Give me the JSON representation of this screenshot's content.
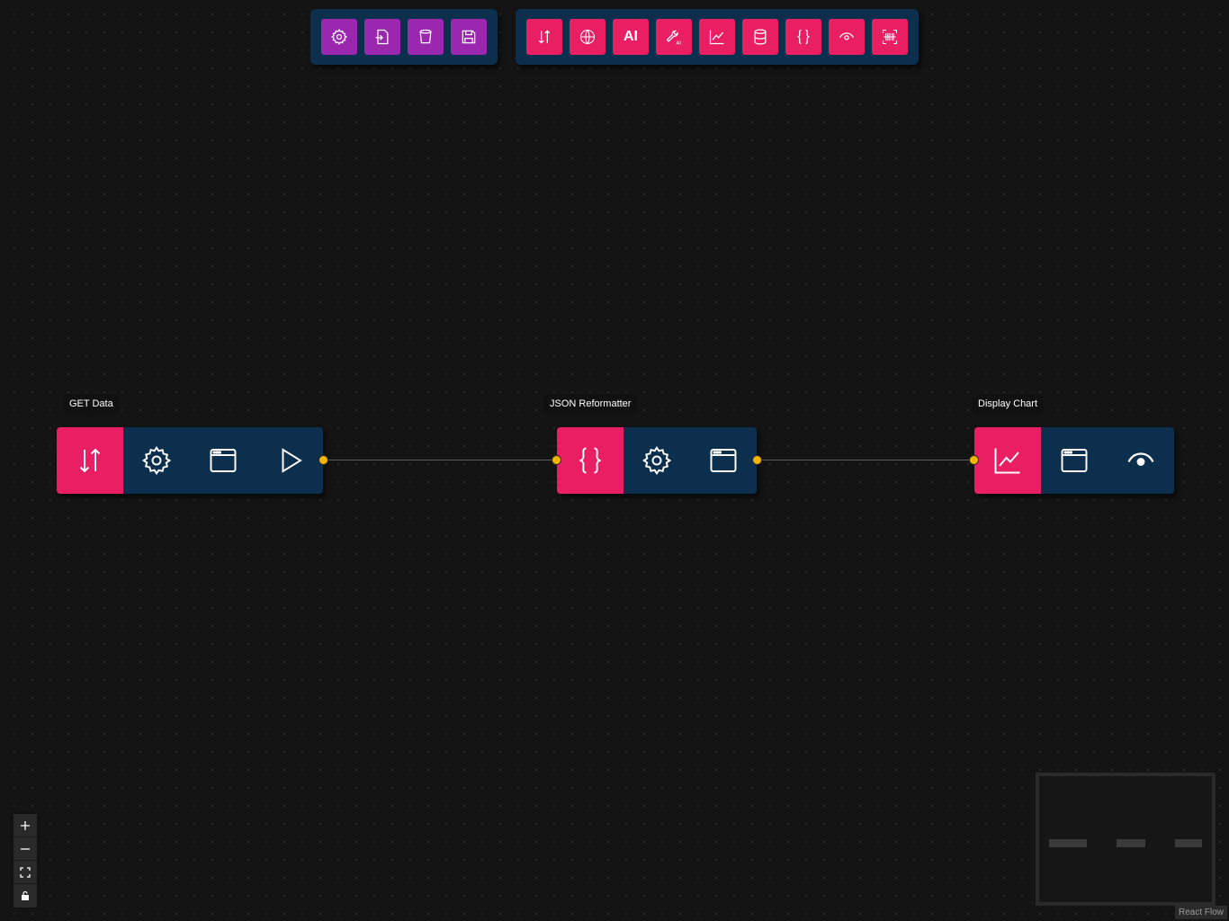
{
  "toolbar_left": {
    "buttons": [
      {
        "icon": "gear-icon",
        "color": "#9b27af"
      },
      {
        "icon": "file-import-icon",
        "color": "#9b27af"
      },
      {
        "icon": "bucket-icon",
        "color": "#9b27af"
      },
      {
        "icon": "save-icon",
        "color": "#9b27af"
      }
    ]
  },
  "toolbar_right": {
    "buttons": [
      {
        "icon": "sort-arrows-icon",
        "color": "#e91e63"
      },
      {
        "icon": "www-globe-icon",
        "color": "#e91e63"
      },
      {
        "icon": "ai-text-icon",
        "label": "AI",
        "color": "#e91e63"
      },
      {
        "icon": "ai-wrench-icon",
        "color": "#e91e63"
      },
      {
        "icon": "line-chart-icon",
        "color": "#e91e63"
      },
      {
        "icon": "database-icon",
        "color": "#e91e63"
      },
      {
        "icon": "braces-icon",
        "color": "#e91e63"
      },
      {
        "icon": "eye-icon",
        "color": "#e91e63"
      },
      {
        "icon": "barcode-scan-icon",
        "color": "#e91e63"
      }
    ]
  },
  "nodes": [
    {
      "label": "GET Data",
      "icons": [
        "sort-arrows-icon",
        "gear-icon",
        "window-icon",
        "play-icon"
      ]
    },
    {
      "label": "JSON Reformatter",
      "icons": [
        "braces-icon",
        "gear-icon",
        "window-icon"
      ]
    },
    {
      "label": "Display Chart",
      "icons": [
        "line-chart-icon",
        "window-icon",
        "eye-icon"
      ]
    }
  ],
  "controls": {
    "icons": [
      "zoom-in-icon",
      "zoom-out-icon",
      "fit-view-icon",
      "lock-icon"
    ]
  },
  "attribution": "React Flow",
  "colors": {
    "background": "#141414",
    "panel": "#0d2f4e",
    "accent_pink": "#e91e63",
    "accent_purple": "#9b27af",
    "handle": "#f5b400"
  }
}
